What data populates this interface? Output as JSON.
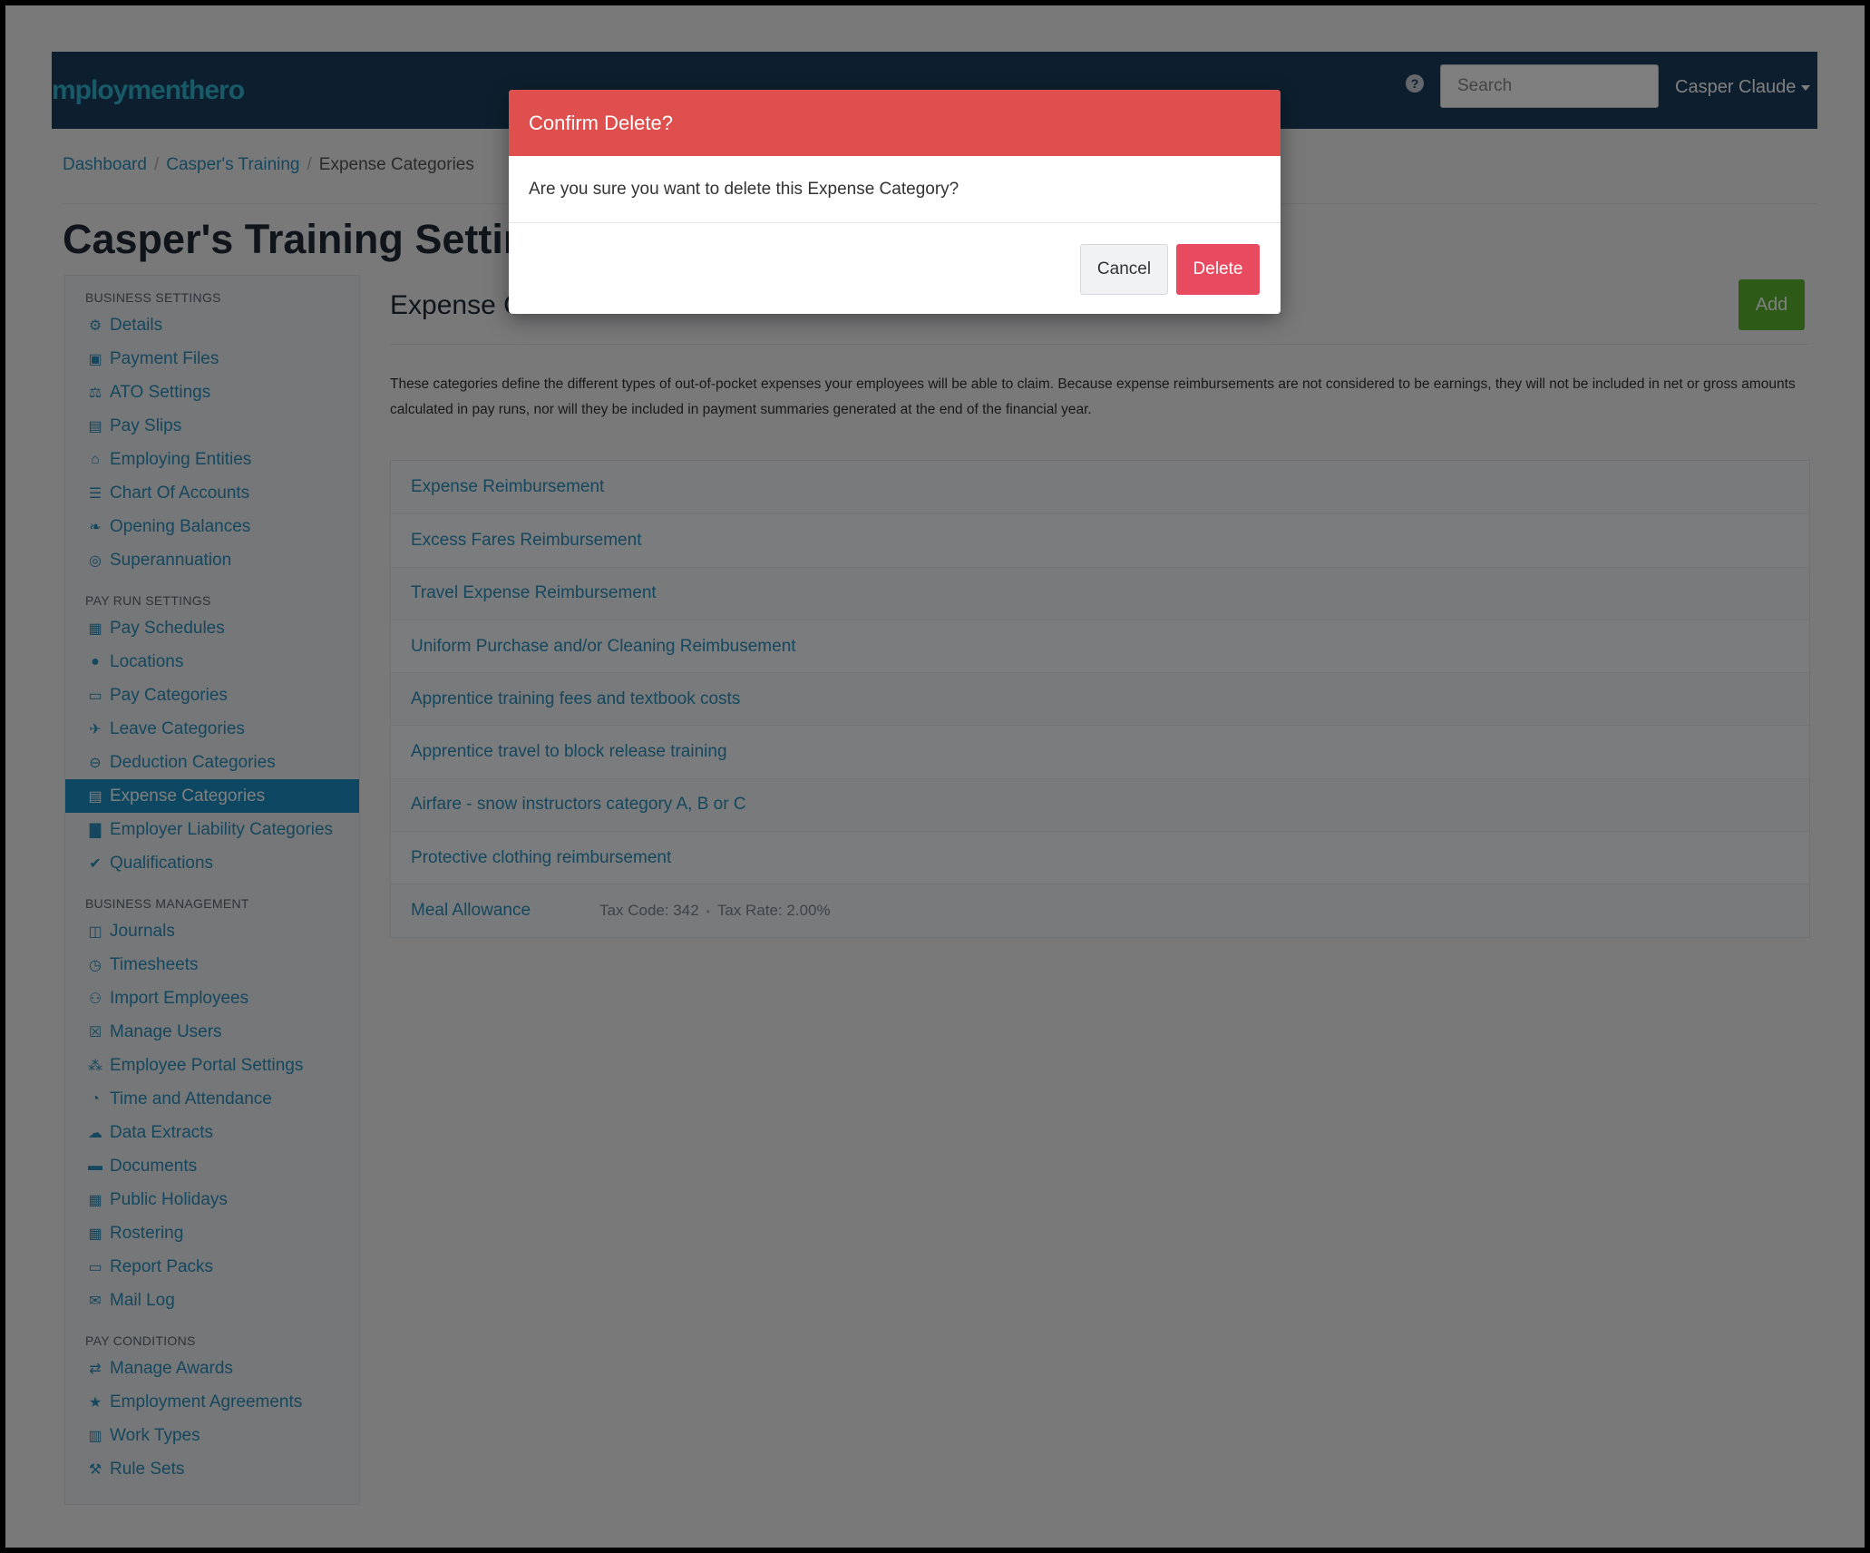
{
  "navbar": {
    "logo": "mploymenthero",
    "search_placeholder": "Search",
    "user_name": "Casper Claude"
  },
  "breadcrumb": {
    "items": [
      "Dashboard",
      "Casper's Training"
    ],
    "current": "Expense Categories"
  },
  "page_title": "Casper's Training Settings",
  "sidebar": {
    "sections": [
      {
        "title": "BUSINESS SETTINGS",
        "items": [
          {
            "label": "Details",
            "icon": "gear-icon"
          },
          {
            "label": "Payment Files",
            "icon": "floppy-icon"
          },
          {
            "label": "ATO Settings",
            "icon": "scale-icon"
          },
          {
            "label": "Pay Slips",
            "icon": "file-icon"
          },
          {
            "label": "Employing Entities",
            "icon": "bank-icon"
          },
          {
            "label": "Chart Of Accounts",
            "icon": "list-icon"
          },
          {
            "label": "Opening Balances",
            "icon": "leaf-icon"
          },
          {
            "label": "Superannuation",
            "icon": "life-ring-icon"
          }
        ]
      },
      {
        "title": "PAY RUN SETTINGS",
        "items": [
          {
            "label": "Pay Schedules",
            "icon": "calendar-icon"
          },
          {
            "label": "Locations",
            "icon": "globe-icon"
          },
          {
            "label": "Pay Categories",
            "icon": "money-icon"
          },
          {
            "label": "Leave Categories",
            "icon": "plane-icon"
          },
          {
            "label": "Deduction Categories",
            "icon": "minus-circle-icon"
          },
          {
            "label": "Expense Categories",
            "icon": "archive-icon",
            "active": true
          },
          {
            "label": "Employer Liability Categories",
            "icon": "chart-icon"
          },
          {
            "label": "Qualifications",
            "icon": "check-icon"
          }
        ]
      },
      {
        "title": "BUSINESS MANAGEMENT",
        "items": [
          {
            "label": "Journals",
            "icon": "columns-icon"
          },
          {
            "label": "Timesheets",
            "icon": "clock-icon"
          },
          {
            "label": "Import Employees",
            "icon": "users-icon"
          },
          {
            "label": "Manage Users",
            "icon": "lock-icon"
          },
          {
            "label": "Employee Portal Settings",
            "icon": "wand-icon"
          },
          {
            "label": "Time and Attendance",
            "icon": "user-clock-icon"
          },
          {
            "label": "Data Extracts",
            "icon": "cloud-download-icon"
          },
          {
            "label": "Documents",
            "icon": "folder-icon"
          },
          {
            "label": "Public Holidays",
            "icon": "calendar-icon"
          },
          {
            "label": "Rostering",
            "icon": "calendar-grid-icon"
          },
          {
            "label": "Report Packs",
            "icon": "folder-open-icon"
          },
          {
            "label": "Mail Log",
            "icon": "envelope-icon"
          }
        ]
      },
      {
        "title": "PAY CONDITIONS",
        "items": [
          {
            "label": "Manage Awards",
            "icon": "exchange-icon"
          },
          {
            "label": "Employment Agreements",
            "icon": "star-icon"
          },
          {
            "label": "Work Types",
            "icon": "book-icon"
          },
          {
            "label": "Rule Sets",
            "icon": "gavel-icon"
          }
        ]
      }
    ]
  },
  "main": {
    "heading": "Expense C",
    "add_label": "Add",
    "description": "These categories define the different types of out-of-pocket expenses your employees will be able to claim. Because expense reimbursements are not considered to be earnings, they will not be included in net or gross amounts calculated in pay runs, nor will they be included in payment summaries generated at the end of the financial year.",
    "categories": [
      {
        "name": "Expense Reimbursement"
      },
      {
        "name": "Excess Fares Reimbursement"
      },
      {
        "name": "Travel Expense Reimbursement"
      },
      {
        "name": "Uniform Purchase and/or Cleaning Reimbusement"
      },
      {
        "name": "Apprentice training fees and textbook costs"
      },
      {
        "name": "Apprentice travel to block release training"
      },
      {
        "name": "Airfare - snow instructors category A, B or C"
      },
      {
        "name": "Protective clothing reimbursement"
      },
      {
        "name": "Meal Allowance",
        "tax_code": "Tax Code: 342",
        "tax_rate": "Tax Rate: 2.00%"
      }
    ]
  },
  "modal": {
    "title": "Confirm Delete?",
    "message": "Are you sure you want to delete this Expense Category?",
    "cancel_label": "Cancel",
    "delete_label": "Delete"
  },
  "colors": {
    "navbar": "#1b3f5c",
    "link": "#2a8fbd",
    "active": "#1c8ec4",
    "add_button": "#5cb531",
    "modal_header": "#df4f4d",
    "delete_button": "#e84a5f"
  }
}
